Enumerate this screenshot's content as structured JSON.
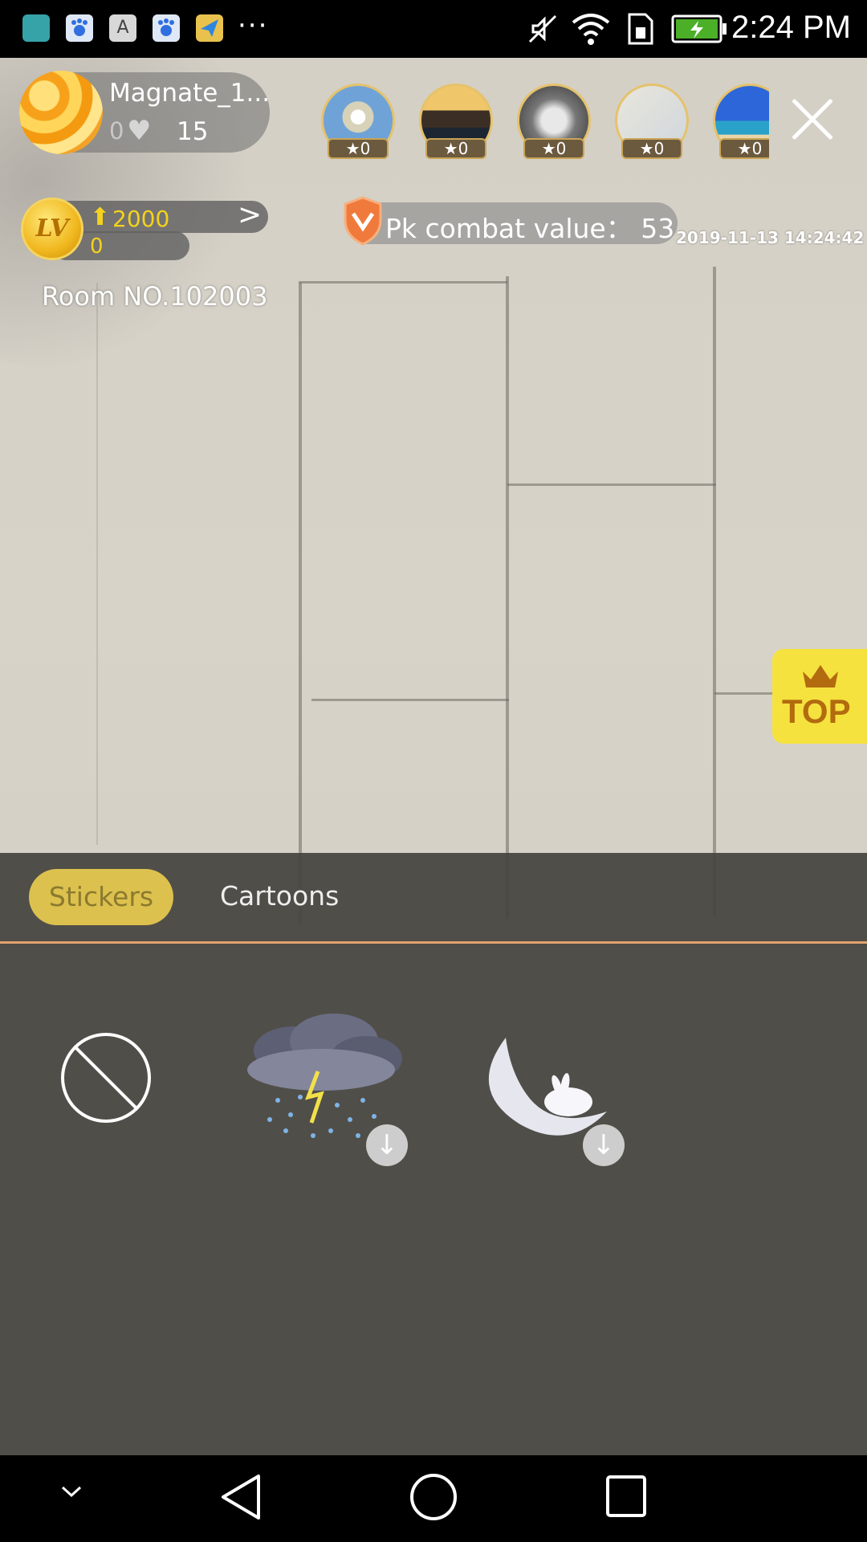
{
  "status_bar": {
    "time": "2:24 PM",
    "more": "···",
    "icons": [
      "android-icon",
      "baidu-icon",
      "font-icon",
      "baidu-icon",
      "maps-icon",
      "mute-icon",
      "wifi-icon",
      "sim-icon",
      "battery-icon"
    ]
  },
  "host": {
    "name": "Magnate_1...",
    "likes": "0",
    "followers": "15"
  },
  "viewers": [
    {
      "stars": "0"
    },
    {
      "stars": "0"
    },
    {
      "stars": "0"
    },
    {
      "stars": "0"
    },
    {
      "stars": "0"
    }
  ],
  "level": {
    "badge": "LV",
    "value": "2000",
    "sub": "0"
  },
  "room": "Room NO.102003",
  "pk": {
    "text": "Pk combat value：  53"
  },
  "timestamp": "2019-11-13 14:24:42",
  "top_badge": "TOP",
  "sticker_panel": {
    "tabs": [
      "Stickers",
      "Cartoons"
    ],
    "active_tab": "Stickers"
  },
  "colors": {
    "accent_yellow": "#dcc14e",
    "tab_line": "#e2a36c",
    "top_badge": "#f6e23e",
    "level_text": "#f4d21e"
  }
}
